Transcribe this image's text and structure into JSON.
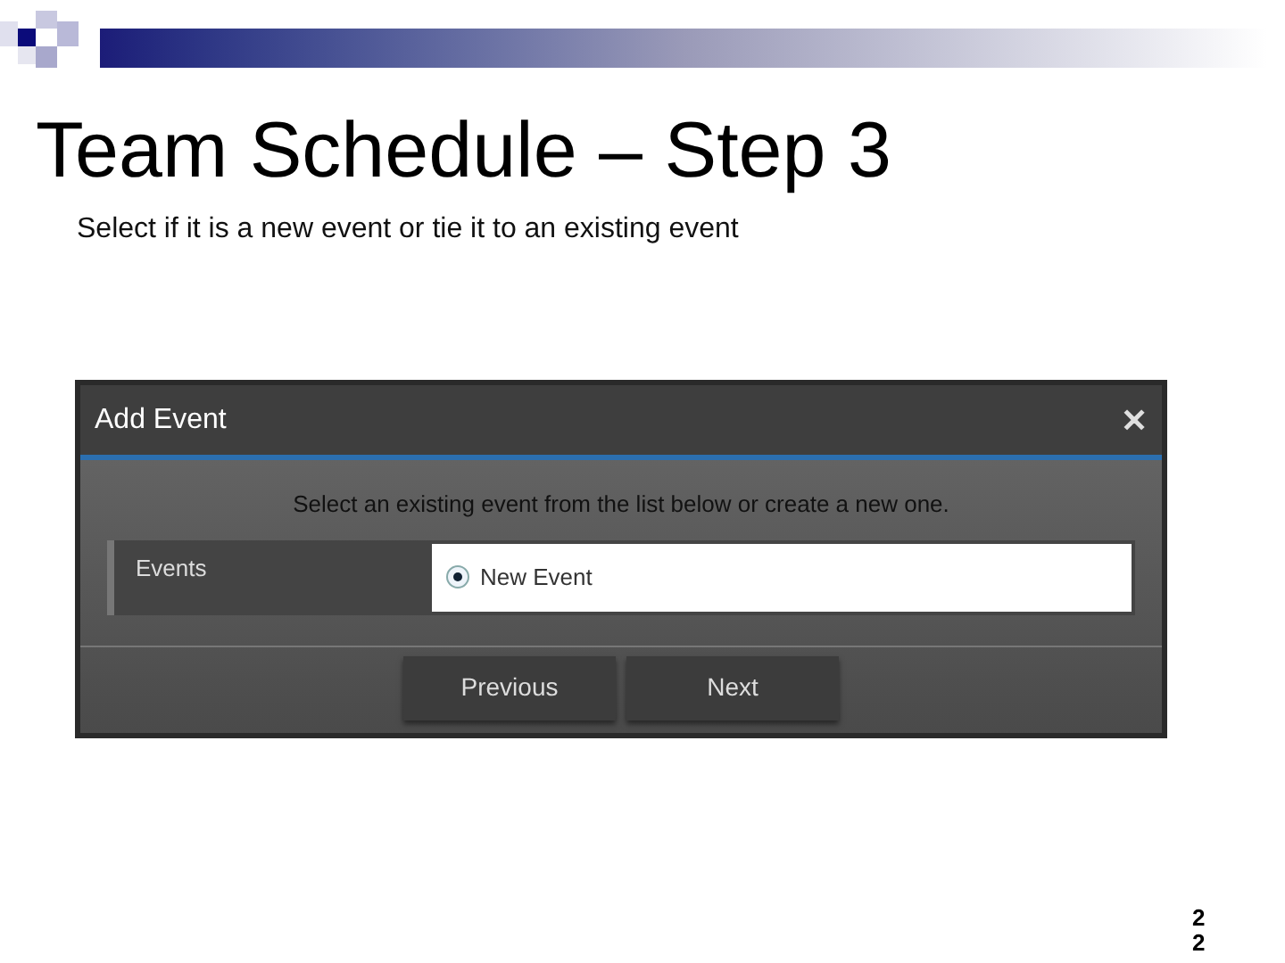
{
  "slide": {
    "title": "Team Schedule – Step 3",
    "subtitle": "Select if it is a new event or tie it to an existing event",
    "page_number": "22"
  },
  "dialog": {
    "title": "Add Event",
    "close": "✕",
    "instruction": "Select an existing event from the list below or create a new one.",
    "field": {
      "label": "Events",
      "options": [
        {
          "label": "New Event",
          "selected": true
        }
      ]
    },
    "buttons": [
      "Previous",
      "Next"
    ]
  }
}
